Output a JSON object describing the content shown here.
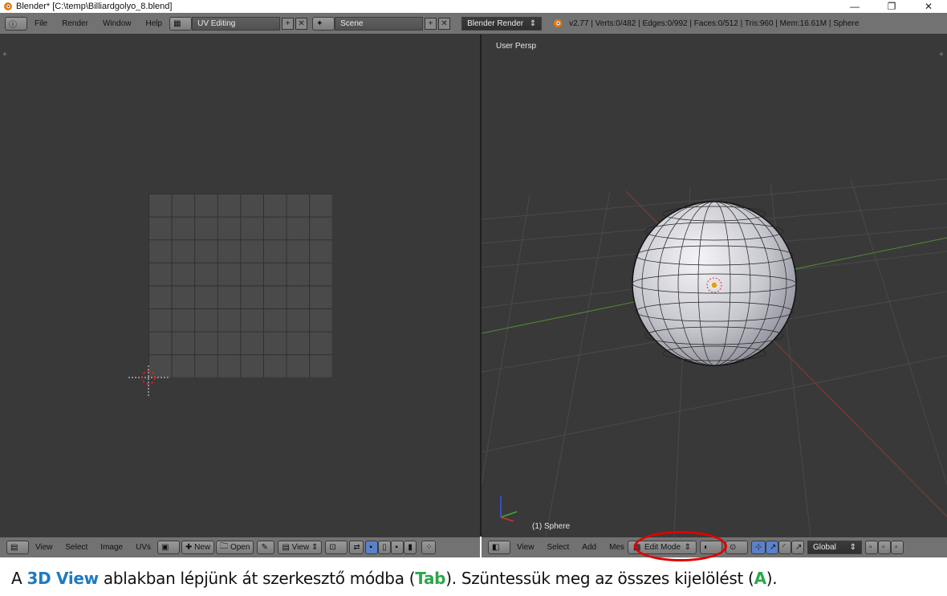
{
  "window": {
    "title": "Blender* [C:\\temp\\Billiardgolyo_8.blend]",
    "minimize": "—",
    "restore": "❐",
    "close": "✕"
  },
  "topbar": {
    "menus": [
      "File",
      "Render",
      "Window",
      "Help"
    ],
    "layout_name": "UV Editing",
    "scene_name": "Scene",
    "render_engine": "Blender Render",
    "stats": "v2.77 | Verts:0/482 | Edges:0/992 | Faces:0/512 | Tris:960 | Mem:16.61M | Sphere"
  },
  "uv_editor": {
    "header": {
      "menus": [
        "View",
        "Select",
        "Image",
        "UVs"
      ],
      "new_label": "New",
      "open_label": "Open",
      "view_label": "View"
    }
  },
  "view3d": {
    "perspective_label": "User Persp",
    "object_label": "(1) Sphere",
    "header": {
      "menus": [
        "View",
        "Select",
        "Add",
        "Mes"
      ],
      "mode": "Edit Mode",
      "orientation": "Global"
    }
  },
  "caption": {
    "p1": "A ",
    "kw1": "3D View",
    "p2": " ablakban lépjünk át szerkesztő módba (",
    "kw2": "Tab",
    "p3": "). Szüntessük meg az összes kijelölést (",
    "kw3": "A",
    "p4": ")."
  },
  "colors": {
    "header_bg": "#727272",
    "editor_bg": "#393939",
    "highlight": "#e00000",
    "caption_blue": "#1f7ac0",
    "caption_green": "#2aa84a"
  }
}
